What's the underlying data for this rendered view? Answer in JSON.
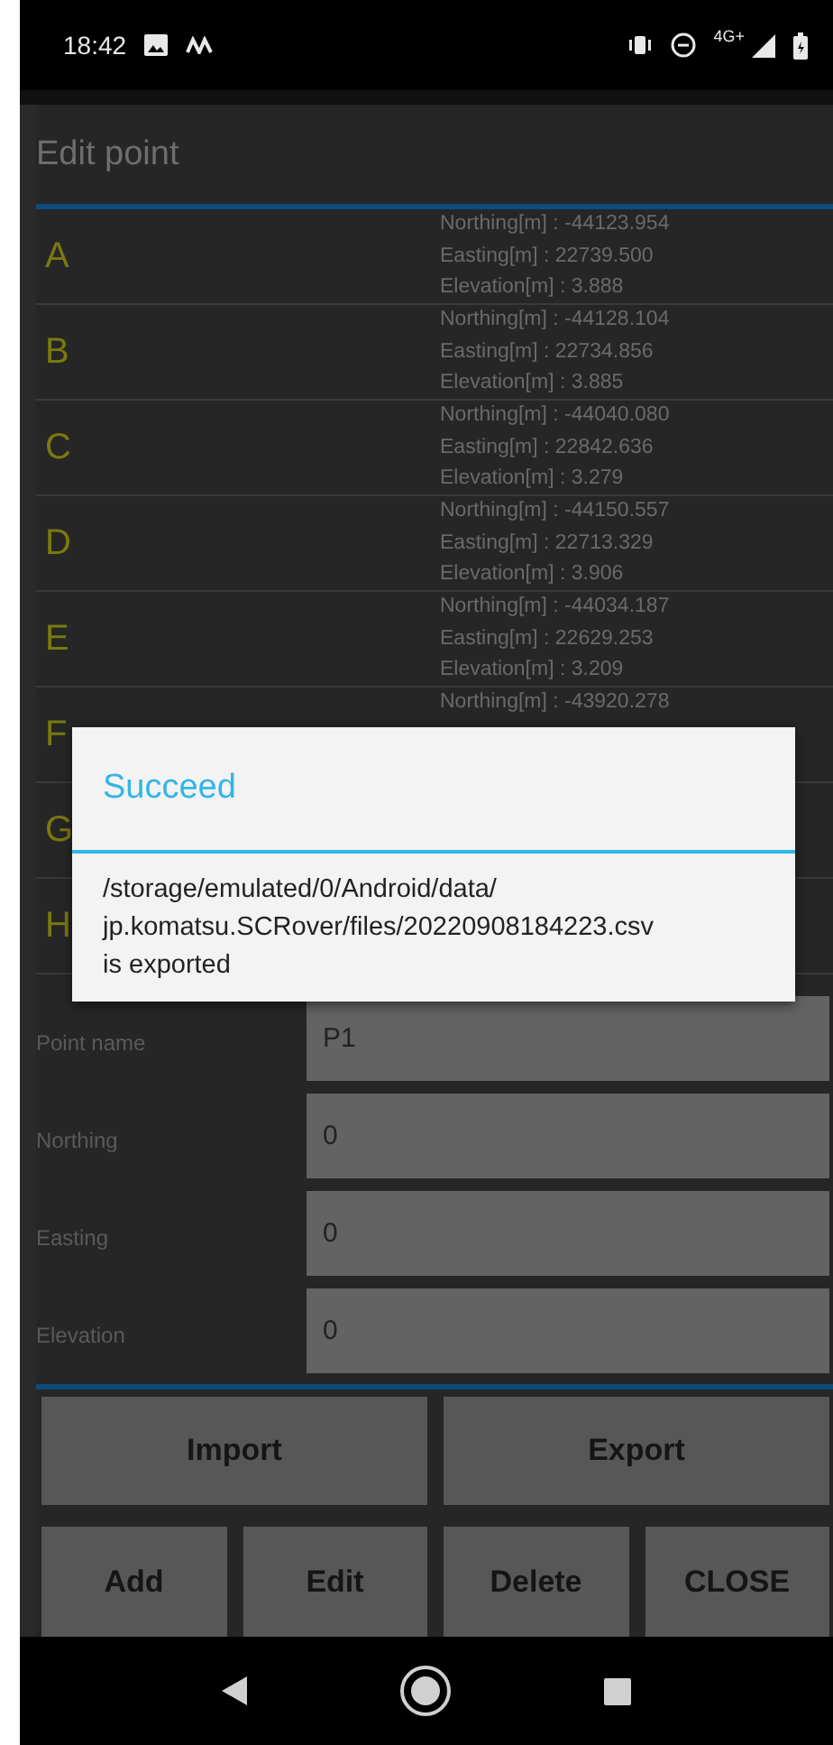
{
  "status_bar": {
    "time": "18:42",
    "network": "4G+"
  },
  "dialog": {
    "title": "Edit point",
    "points": [
      {
        "name": "A",
        "lines": [
          "Northing[m] : -44123.954",
          "Easting[m] : 22739.500",
          "Elevation[m] : 3.888"
        ]
      },
      {
        "name": "B",
        "lines": [
          "Northing[m] : -44128.104",
          "Easting[m] : 22734.856",
          "Elevation[m] : 3.885"
        ]
      },
      {
        "name": "C",
        "lines": [
          "Northing[m] : -44040.080",
          "Easting[m] : 22842.636",
          "Elevation[m] : 3.279"
        ]
      },
      {
        "name": "D",
        "lines": [
          "Northing[m] : -44150.557",
          "Easting[m] : 22713.329",
          "Elevation[m] : 3.906"
        ]
      },
      {
        "name": "E",
        "lines": [
          "Northing[m] : -44034.187",
          "Easting[m] : 22629.253",
          "Elevation[m] : 3.209"
        ]
      },
      {
        "name": "F",
        "lines": [
          "Northing[m] : -43920.278"
        ]
      },
      {
        "name": "G"
      },
      {
        "name": "H"
      }
    ],
    "fields": [
      {
        "label": "Point name",
        "value": "P1"
      },
      {
        "label": "Northing",
        "value": "0"
      },
      {
        "label": "Easting",
        "value": "0"
      },
      {
        "label": "Elevation",
        "value": "0"
      }
    ],
    "buttons_top": [
      "Import",
      "Export"
    ],
    "buttons_bottom": [
      "Add",
      "Edit",
      "Delete",
      "CLOSE"
    ]
  },
  "alert": {
    "title": "Succeed",
    "message": "/storage/emulated/0/Android/data/\njp.komatsu.SCRover/files/20220908184223.csv\nis exported"
  }
}
